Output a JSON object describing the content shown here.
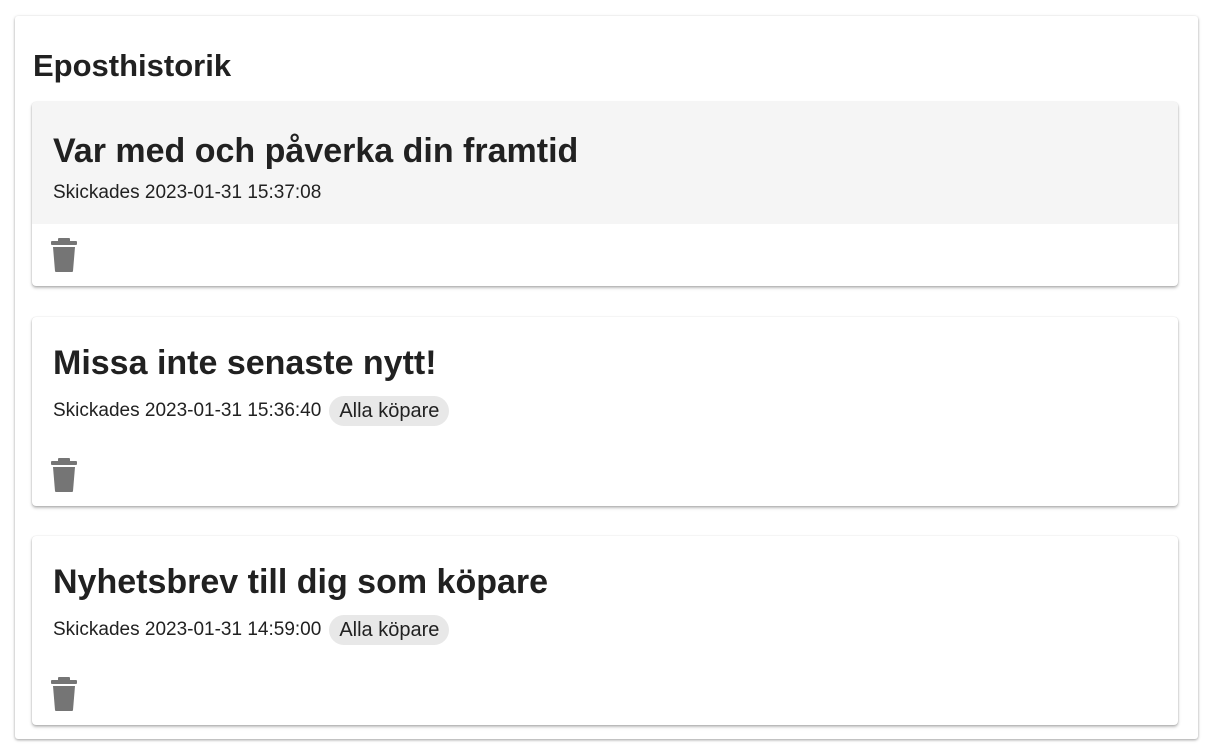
{
  "panel": {
    "title": "Eposthistorik"
  },
  "emails": [
    {
      "subject": "Var med och påverka din framtid",
      "sent_text": "Skickades 2023-01-31 15:37:08",
      "audience": ""
    },
    {
      "subject": "Missa inte senaste nytt!",
      "sent_text": "Skickades 2023-01-31 15:36:40",
      "audience": "Alla köpare"
    },
    {
      "subject": "Nyhetsbrev till dig som köpare",
      "sent_text": "Skickades 2023-01-31 14:59:00",
      "audience": "Alla köpare"
    }
  ],
  "icons": {
    "delete": "trash-icon"
  },
  "colors": {
    "selected_header": "#f5f5f5",
    "icon": "#757575",
    "chip": "#e8e8e8",
    "text": "#212121"
  }
}
